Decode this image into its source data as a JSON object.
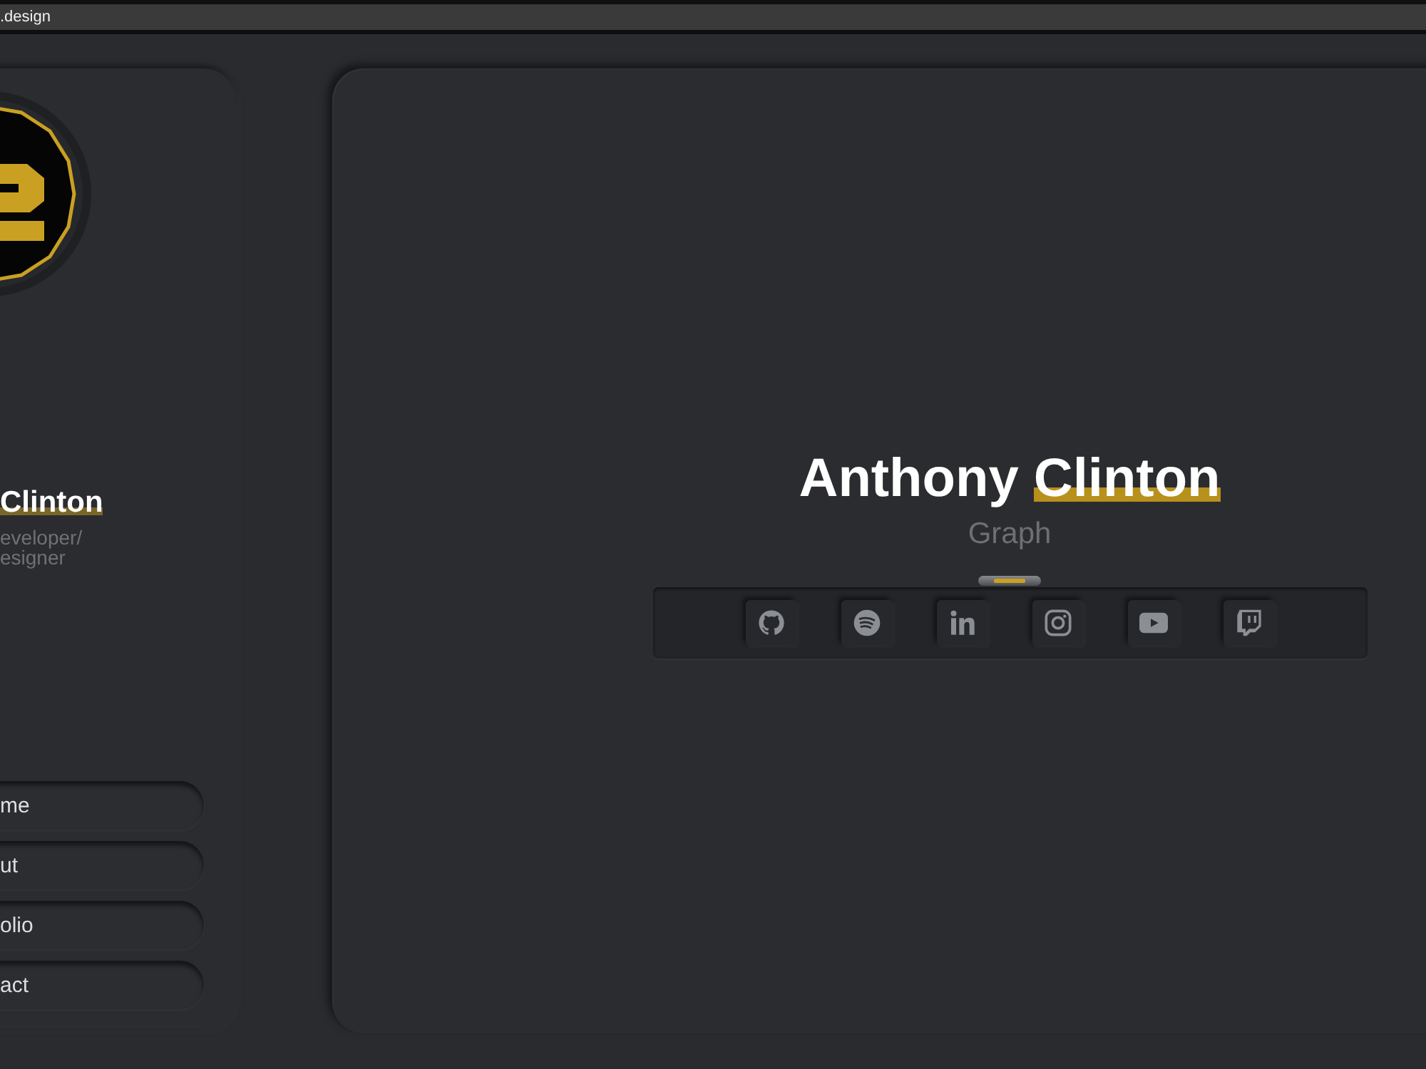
{
  "browser_tab": {
    "title": ".design"
  },
  "sidebar": {
    "name": "Clinton",
    "role": "eveloper/\nesigner",
    "nav": [
      {
        "label": "me"
      },
      {
        "label": "ut"
      },
      {
        "label": "olio"
      },
      {
        "label": "act"
      }
    ]
  },
  "hero": {
    "name_plain": "Anthony",
    "name_highlight": "Clinton",
    "subtitle": "Graph",
    "socials": [
      {
        "kind": "github"
      },
      {
        "kind": "spotify"
      },
      {
        "kind": "linkedin"
      },
      {
        "kind": "instagram"
      },
      {
        "kind": "youtube"
      },
      {
        "kind": "twitch"
      }
    ]
  }
}
